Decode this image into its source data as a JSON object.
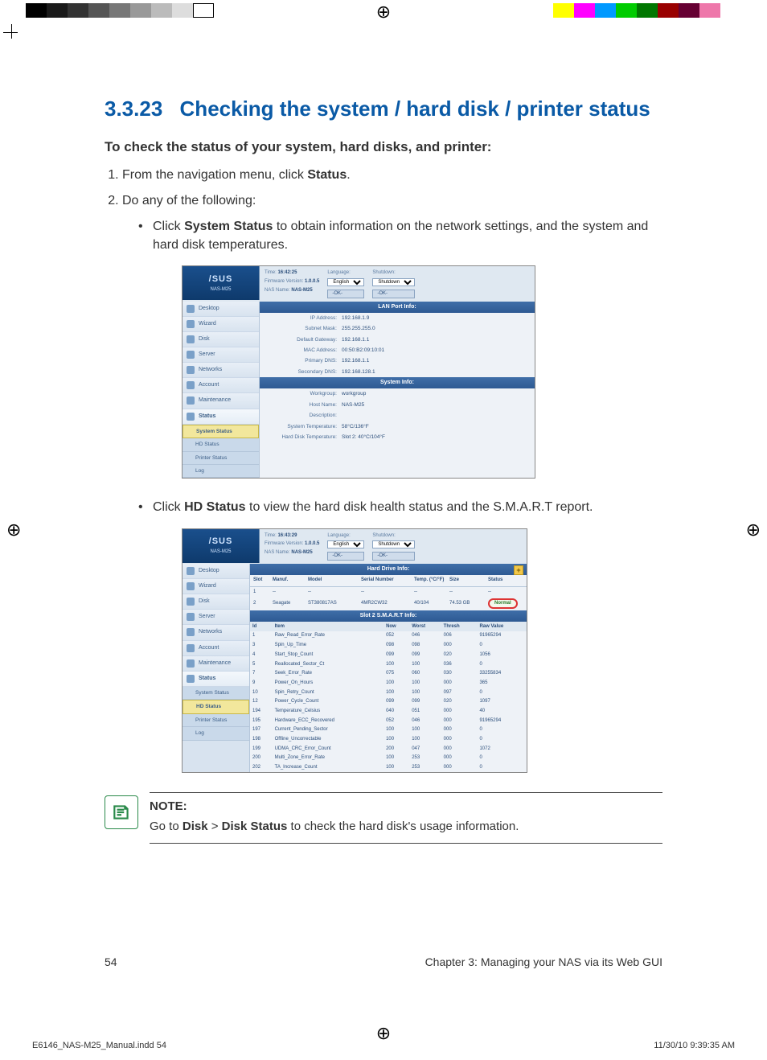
{
  "section": {
    "number": "3.3.23",
    "title": "Checking the system / hard disk / printer status"
  },
  "lead": "To check the status of your system, hard disks, and printer:",
  "steps": {
    "s1_pre": "From the navigation menu, click ",
    "s1_b": "Status",
    "s1_post": ".",
    "s2": "Do any of the following:",
    "b1_pre": "Click ",
    "b1_b": "System Status",
    "b1_post": " to obtain information on the network settings, and the system and hard disk temperatures.",
    "b2_pre": "Click ",
    "b2_b": "HD Status",
    "b2_post": " to view the hard disk health status and the S.M.A.R.T report."
  },
  "shot_common": {
    "logo_brand": "/SUS",
    "logo_model": "NAS-M25",
    "time_lbl": "Time:",
    "fw_lbl": "Firmware Version:",
    "name_lbl": "NAS Name:",
    "lang_lbl": "Language:",
    "shut_lbl": "Shutdown:",
    "ok": "-OK-",
    "lang_val": "English",
    "shut_val": "Shutdown",
    "nas_name": "NAS-M25"
  },
  "shot1": {
    "time": "16:42:25",
    "fw": "1.0.0.5",
    "nav": [
      "Desktop",
      "Wizard",
      "Disk",
      "Server",
      "Networks",
      "Account",
      "Maintenance"
    ],
    "nav_status": "Status",
    "nav_sub": [
      "System Status",
      "HD Status",
      "Printer Status",
      "Log"
    ],
    "lan_title": "LAN Port Info:",
    "sys_title": "System Info:",
    "lan": [
      {
        "k": "IP Address:",
        "v": "192.168.1.9"
      },
      {
        "k": "Subnet Mask:",
        "v": "255.255.255.0"
      },
      {
        "k": "Default Gateway:",
        "v": "192.168.1.1"
      },
      {
        "k": "MAC Address:",
        "v": "00:50:B2:09:10:01"
      },
      {
        "k": "Primary DNS:",
        "v": "192.168.1.1"
      },
      {
        "k": "Secondary DNS:",
        "v": "192.168.128.1"
      }
    ],
    "sys": [
      {
        "k": "Workgroup:",
        "v": "workgroup"
      },
      {
        "k": "Host Name:",
        "v": "NAS-M25"
      },
      {
        "k": "Description:",
        "v": ""
      },
      {
        "k": "System Temperature:",
        "v": "58°C/136°F"
      },
      {
        "k": "Hard Disk Temperature:",
        "v": "Slot 2: 40°C/104°F"
      }
    ]
  },
  "shot2": {
    "time": "16:43:29",
    "fw": "1.0.0.5",
    "nav": [
      "Desktop",
      "Wizard",
      "Disk",
      "Server",
      "Networks",
      "Account",
      "Maintenance"
    ],
    "nav_status": "Status",
    "nav_sub": [
      "System Status",
      "HD Status",
      "Printer Status",
      "Log"
    ],
    "hd_title": "Hard Drive Info:",
    "hd_head": [
      "Slot",
      "Manuf.",
      "Model",
      "Serial Number",
      "Temp. (°C/°F)",
      "Size",
      "Status"
    ],
    "hd_rows": [
      [
        "1",
        "--",
        "--",
        "--",
        "--",
        "--",
        "--"
      ],
      [
        "2",
        "Seagate",
        "ST380817AS",
        "4MR2CW32",
        "40/104",
        "74.53 GB",
        "Normal"
      ]
    ],
    "smart_title": "Slot 2 S.M.A.R.T Info:",
    "smart_head": [
      "Id",
      "Item",
      "Now",
      "Worst",
      "Thresh",
      "Raw Value"
    ],
    "smart_rows": [
      [
        "1",
        "Raw_Read_Error_Rate",
        "052",
        "046",
        "006",
        "91965294"
      ],
      [
        "3",
        "Spin_Up_Time",
        "098",
        "098",
        "000",
        "0"
      ],
      [
        "4",
        "Start_Stop_Count",
        "099",
        "099",
        "020",
        "1056"
      ],
      [
        "5",
        "Reallocated_Sector_Ct",
        "100",
        "100",
        "036",
        "0"
      ],
      [
        "7",
        "Seek_Error_Rate",
        "075",
        "060",
        "030",
        "33255834"
      ],
      [
        "9",
        "Power_On_Hours",
        "100",
        "100",
        "000",
        "365"
      ],
      [
        "10",
        "Spin_Retry_Count",
        "100",
        "100",
        "097",
        "0"
      ],
      [
        "12",
        "Power_Cycle_Count",
        "099",
        "099",
        "020",
        "1097"
      ],
      [
        "194",
        "Temperature_Celsius",
        "040",
        "051",
        "000",
        "40"
      ],
      [
        "195",
        "Hardware_ECC_Recovered",
        "052",
        "046",
        "000",
        "91965294"
      ],
      [
        "197",
        "Current_Pending_Sector",
        "100",
        "100",
        "000",
        "0"
      ],
      [
        "198",
        "Offline_Uncorrectable",
        "100",
        "100",
        "000",
        "0"
      ],
      [
        "199",
        "UDMA_CRC_Error_Count",
        "200",
        "047",
        "000",
        "1072"
      ],
      [
        "200",
        "Multi_Zone_Error_Rate",
        "100",
        "253",
        "000",
        "0"
      ],
      [
        "202",
        "TA_Increase_Count",
        "100",
        "253",
        "000",
        "0"
      ]
    ]
  },
  "note": {
    "title": "NOTE:",
    "pre": "Go to ",
    "b1": "Disk",
    "gt": " > ",
    "b2": "Disk Status",
    "post": " to check the hard disk's usage information."
  },
  "footer": {
    "page": "54",
    "chapter": "Chapter 3: Managing your NAS via its Web GUI"
  },
  "imprint": {
    "file": "E6146_NAS-M25_Manual.indd   54",
    "dt": "11/30/10   9:39:35 AM"
  },
  "colorbars": {
    "left": [
      "#000",
      "#1a1a1a",
      "#333",
      "#555",
      "#777",
      "#999",
      "#bbb",
      "#ddd",
      "#fff"
    ],
    "right": [
      "#fff",
      "#ff0",
      "#f0f",
      "#09f",
      "#0c0",
      "#070",
      "#900",
      "#603",
      "#e7a",
      "#fff"
    ]
  }
}
